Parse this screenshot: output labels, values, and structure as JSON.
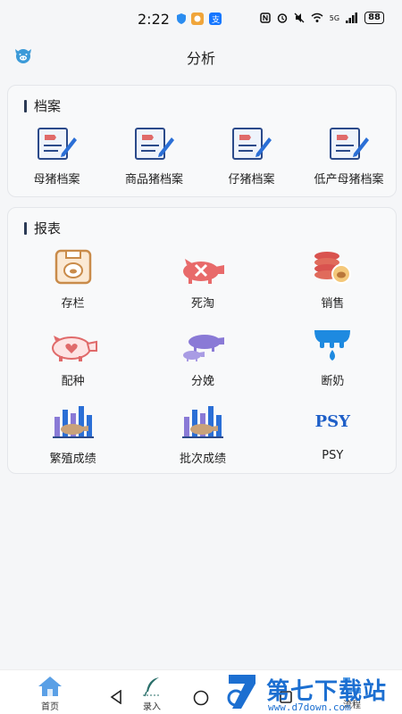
{
  "status_bar": {
    "time": "2:22",
    "battery": "88",
    "signal": "5G"
  },
  "header": {
    "title": "分析"
  },
  "archive_section": {
    "title": "档案",
    "items": [
      {
        "label": "母猪档案"
      },
      {
        "label": "商品猪档案"
      },
      {
        "label": "仔猪档案"
      },
      {
        "label": "低产母猪档案"
      }
    ]
  },
  "report_section": {
    "title": "报表",
    "items": [
      {
        "label": "存栏"
      },
      {
        "label": "死淘"
      },
      {
        "label": "销售"
      },
      {
        "label": "配种"
      },
      {
        "label": "分娩"
      },
      {
        "label": "断奶"
      },
      {
        "label": "繁殖成绩"
      },
      {
        "label": "批次成绩"
      },
      {
        "label": "PSY",
        "icon_text": "PSY"
      }
    ]
  },
  "bottom_nav": {
    "home": "首页",
    "entry": "录入",
    "flow": "流程"
  },
  "watermark": {
    "title": "第七下载站",
    "url": "www.d7down.com"
  },
  "colors": {
    "accent": "#2b6fd6",
    "red": "#e86a6a",
    "purple": "#8a7ad6",
    "blue": "#1e8ae0"
  }
}
